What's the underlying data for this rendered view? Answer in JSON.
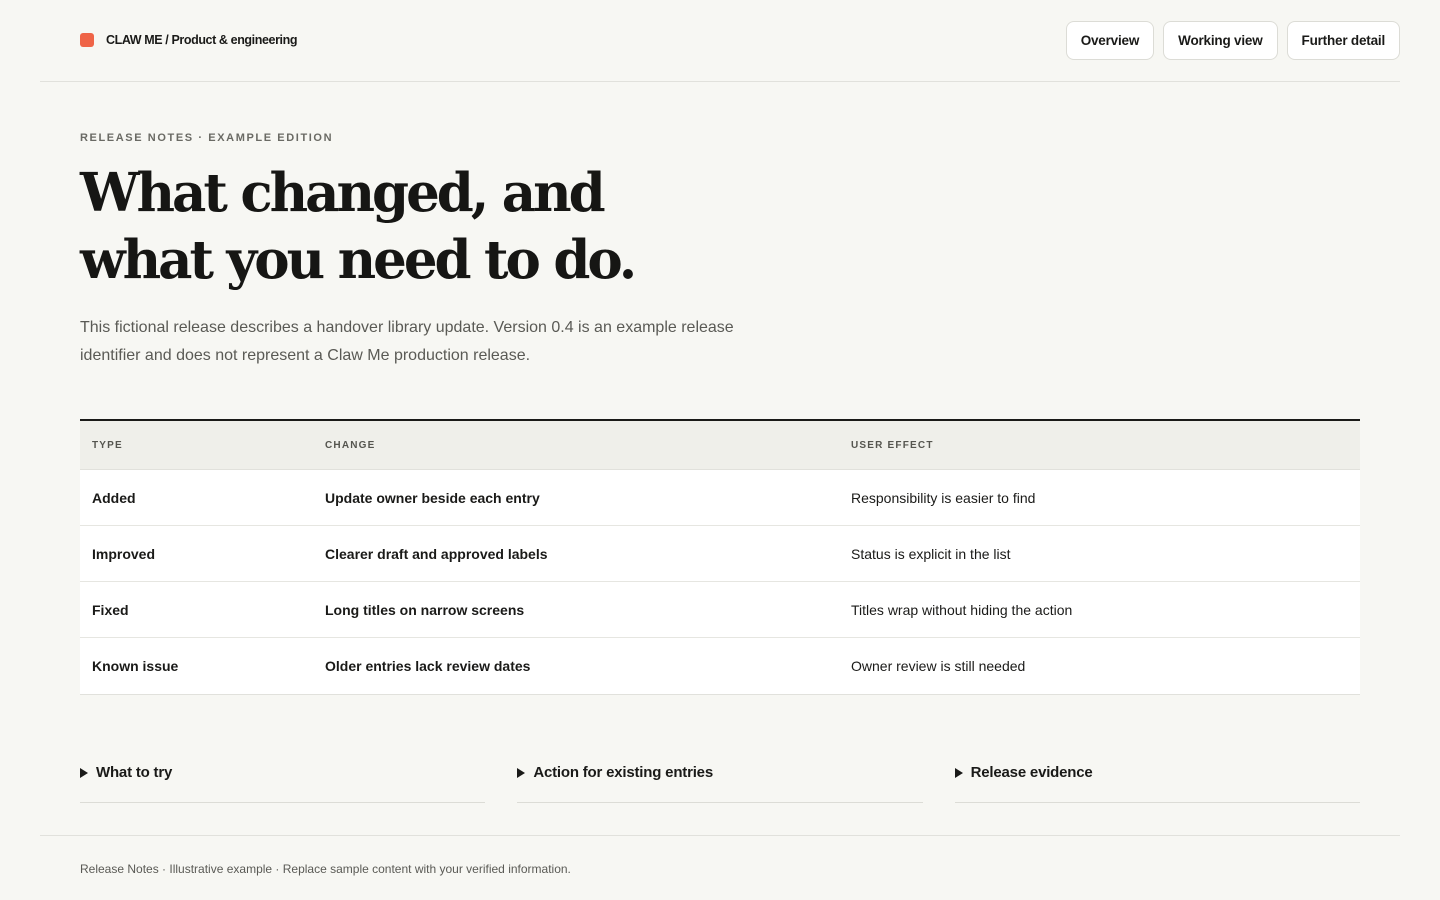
{
  "brand": {
    "name": "CLAW ME / Product & engineering",
    "accent": "#ef6447"
  },
  "nav": {
    "items": [
      {
        "label": "Overview"
      },
      {
        "label": "Working view"
      },
      {
        "label": "Further detail"
      }
    ]
  },
  "hero": {
    "eyebrow": "RELEASE NOTES · EXAMPLE EDITION",
    "title_line1": "What changed, and",
    "title_line2": "what you need to do.",
    "lede": "This fictional release describes a handover library update. Version 0.4 is an example release identifier and does not represent a Claw Me production release."
  },
  "table": {
    "headers": [
      "TYPE",
      "CHANGE",
      "USER EFFECT"
    ],
    "rows": [
      {
        "type": "Added",
        "change": "Update owner beside each entry",
        "effect": "Responsibility is easier to find"
      },
      {
        "type": "Improved",
        "change": "Clearer draft and approved labels",
        "effect": "Status is explicit in the list"
      },
      {
        "type": "Fixed",
        "change": "Long titles on narrow screens",
        "effect": "Titles wrap without hiding the action"
      },
      {
        "type": "Known issue",
        "change": "Older entries lack review dates",
        "effect": "Owner review is still needed"
      }
    ]
  },
  "details": [
    {
      "label": "What to try",
      "icon": "triangle-right-icon"
    },
    {
      "label": "Action for existing entries",
      "icon": "triangle-right-icon"
    },
    {
      "label": "Release evidence",
      "icon": "triangle-right-icon"
    }
  ],
  "footer": {
    "text": "Release Notes · Illustrative example · Replace sample content with your verified information."
  }
}
